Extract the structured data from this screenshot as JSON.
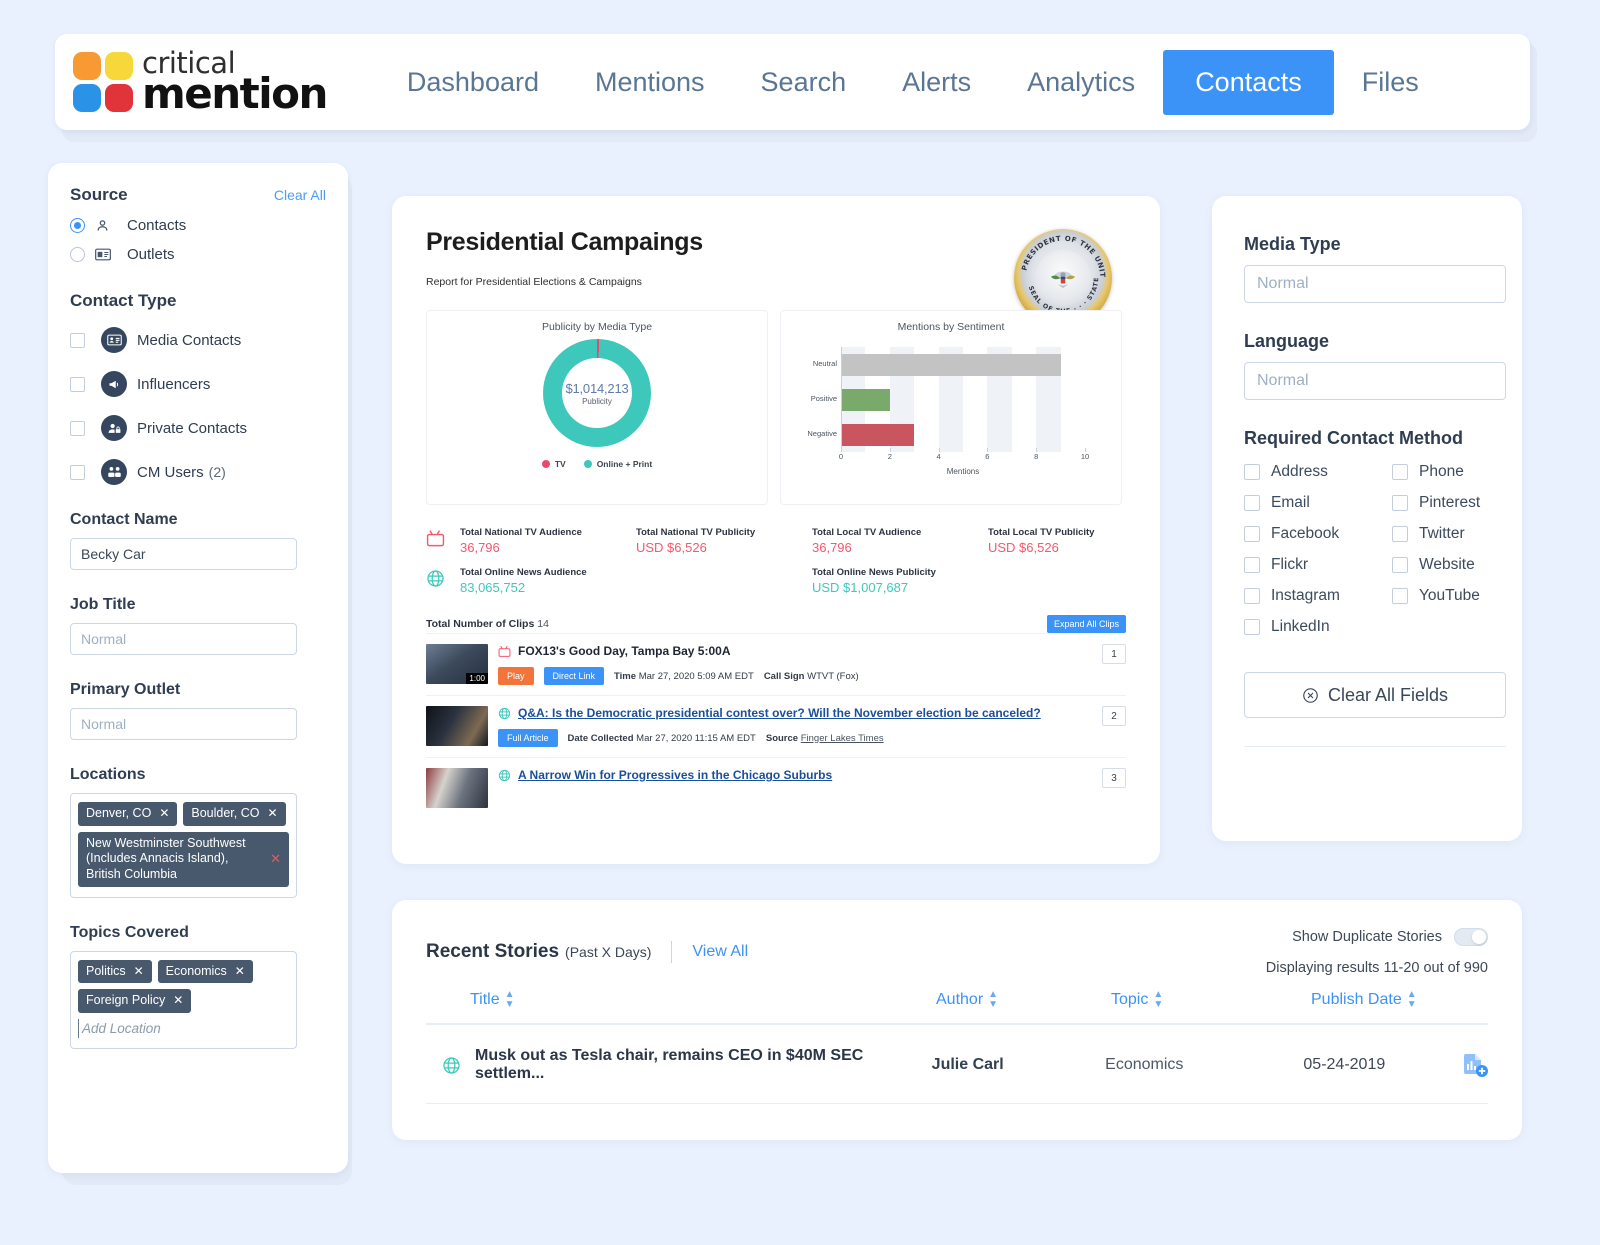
{
  "header": {
    "brand": {
      "line1": "critical",
      "line2": "mention"
    },
    "nav": [
      {
        "label": "Dashboard",
        "active": false
      },
      {
        "label": "Mentions",
        "active": false
      },
      {
        "label": "Search",
        "active": false
      },
      {
        "label": "Alerts",
        "active": false
      },
      {
        "label": "Analytics",
        "active": false
      },
      {
        "label": "Contacts",
        "active": true
      },
      {
        "label": "Files",
        "active": false
      }
    ]
  },
  "sidebar": {
    "source": {
      "title": "Source",
      "clear_all": "Clear All",
      "options": [
        {
          "label": "Contacts",
          "selected": true
        },
        {
          "label": "Outlets",
          "selected": false
        }
      ]
    },
    "contact_type": {
      "title": "Contact Type",
      "items": [
        {
          "label": "Media Contacts",
          "count": ""
        },
        {
          "label": "Influencers",
          "count": ""
        },
        {
          "label": "Private Contacts",
          "count": ""
        },
        {
          "label": "CM Users",
          "count": "(2)"
        }
      ]
    },
    "contact_name": {
      "label": "Contact Name",
      "value": "Becky Car",
      "placeholder": "Normal"
    },
    "job_title": {
      "label": "Job Title",
      "value": "",
      "placeholder": "Normal"
    },
    "primary_outlet": {
      "label": "Primary Outlet",
      "value": "",
      "placeholder": "Normal"
    },
    "locations": {
      "label": "Locations",
      "tags": [
        "Denver, CO",
        "Boulder, CO"
      ],
      "multiline_tag": "New Westminster Southwest (Includes Annacis Island), British Columbia"
    },
    "topics": {
      "label": "Topics Covered",
      "tags": [
        "Politics",
        "Economics",
        "Foreign Policy"
      ],
      "placeholder": "Add Location"
    }
  },
  "report": {
    "title": "Presidential Campaings",
    "subtitle": "Report for Presidential Elections & Campaigns",
    "seal_text_top": "SEAL OF THE PRESIDENT OF THE UNITED STATES",
    "stats": [
      {
        "label": "Total National TV Audience",
        "value": "36,796",
        "color": "red"
      },
      {
        "label": "Total National TV Publicity",
        "value": "USD $6,526",
        "color": "red"
      },
      {
        "label": "Total Local TV Audience",
        "value": "36,796",
        "color": "red"
      },
      {
        "label": "Total Local TV Publicity",
        "value": "USD $6,526",
        "color": "red"
      },
      {
        "label": "Total Online News Audience",
        "value": "83,065,752",
        "color": "teal"
      },
      {
        "label": "Total Online News Publicity",
        "value": "USD $1,007,687",
        "color": "teal"
      }
    ],
    "clips_label": "Total Number of Clips",
    "clips_count": "14",
    "expand_all": "Expand All Clips",
    "clips": [
      {
        "num": "1",
        "kind": "tv",
        "title": "FOX13's Good Day, Tampa Bay 5:00A",
        "duration": "1:00",
        "btn1": "Play",
        "btn2": "Direct Link",
        "meta1_label": "Time",
        "meta1_value": "Mar 27, 2020 5:09 AM EDT",
        "meta2_label": "Call Sign",
        "meta2_value": "WTVT (Fox)"
      },
      {
        "num": "2",
        "kind": "online",
        "title": "Q&A: Is the Democratic presidential contest over? Will the November election be canceled?",
        "btn1": "Full Article",
        "meta1_label": "Date Collected",
        "meta1_value": "Mar 27, 2020 11:15 AM EDT",
        "meta2_label": "Source",
        "meta2_value": "Finger Lakes Times"
      },
      {
        "num": "3",
        "kind": "online",
        "title": "A Narrow Win for Progressives in the Chicago Suburbs"
      }
    ]
  },
  "chart_data": [
    {
      "type": "pie",
      "title": "Publicity by Media Type",
      "center_value": "$1,014,213",
      "center_label": "Publicity",
      "labels": [
        "TV",
        "Online + Print"
      ],
      "values": [
        6526,
        1007687
      ],
      "colors": [
        "#e8486b",
        "#3ec8bb"
      ],
      "legend_position": "bottom"
    },
    {
      "type": "bar",
      "orientation": "horizontal",
      "title": "Mentions by Sentiment",
      "categories": [
        "Neutral",
        "Positive",
        "Negative"
      ],
      "values": [
        9,
        2,
        3
      ],
      "colors": [
        "#c3c3c3",
        "#79a96b",
        "#c9555e"
      ],
      "xlabel": "Mentions",
      "ylabel": "",
      "xlim": [
        0,
        10
      ],
      "xticks": [
        "0",
        "2",
        "4",
        "6",
        "8",
        "10"
      ],
      "grid": true
    }
  ],
  "right_panel": {
    "media_type": {
      "label": "Media Type",
      "placeholder": "Normal",
      "value": ""
    },
    "language": {
      "label": "Language",
      "placeholder": "Normal",
      "value": ""
    },
    "contact_method": {
      "label": "Required Contact Method",
      "left": [
        "Address",
        "Email",
        "Facebook",
        "Flickr",
        "Instagram",
        "LinkedIn"
      ],
      "right": [
        "Phone",
        "Pinterest",
        "Twitter",
        "Website",
        "YouTube"
      ]
    },
    "clear_all_fields": "Clear All Fields"
  },
  "stories": {
    "title": "Recent Stories",
    "subtitle": "(Past X Days)",
    "view_all": "View All",
    "duplicate_label": "Show Duplicate Stories",
    "displaying": "Displaying results 11-20 out of 990",
    "columns": [
      "Title",
      "Author",
      "Topic",
      "Publish Date"
    ],
    "rows": [
      {
        "title": "Musk out as Tesla chair, remains CEO in $40M SEC settlem...",
        "author": "Julie Carl",
        "topic": "Economics",
        "date": "05-24-2019"
      }
    ]
  },
  "colors": {
    "accent_blue": "#3c93f7",
    "teal": "#3ec8bb",
    "red": "#f3596f",
    "dark_navy": "#35465e",
    "tag_slate": "#48586d",
    "page_bg": "#eaf1fe"
  }
}
